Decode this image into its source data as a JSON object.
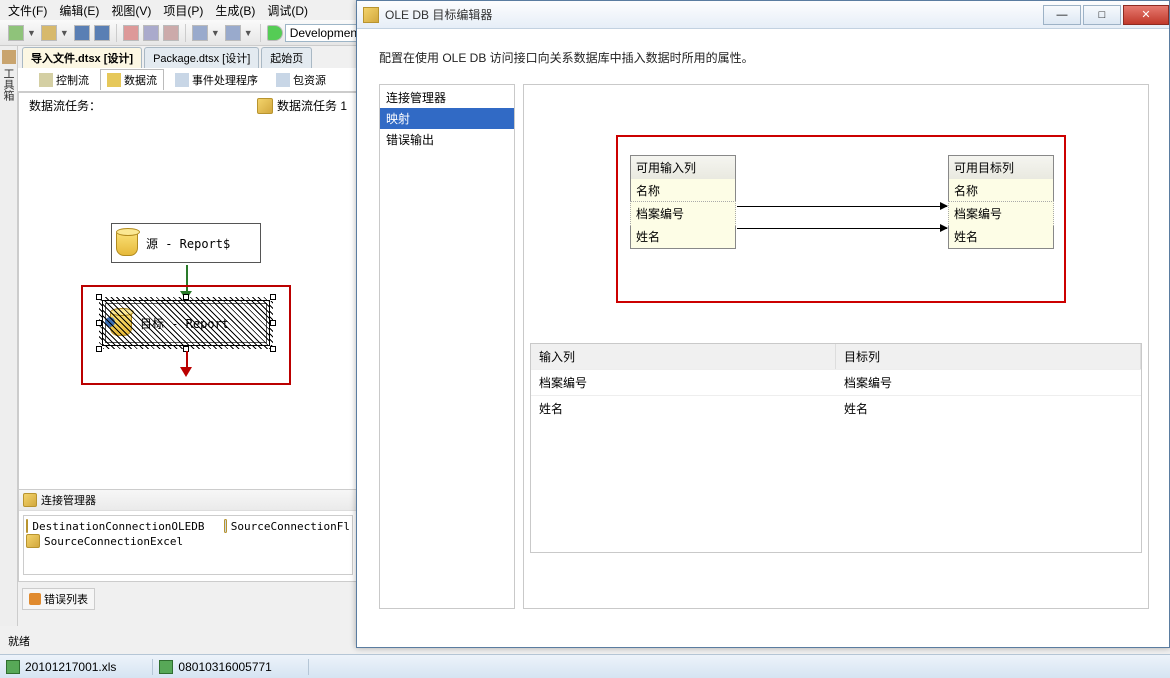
{
  "menu": {
    "file": "文件(F)",
    "edit": "编辑(E)",
    "view": "视图(V)",
    "project": "项目(P)",
    "build": "生成(B)",
    "debug": "调试(D)"
  },
  "toolbar": {
    "config": "Developmen"
  },
  "doctabs": {
    "t1": "导入文件.dtsx [设计]",
    "t2": "Package.dtsx [设计]",
    "t3": "起始页"
  },
  "subtabs": {
    "control": "控制流",
    "data": "数据流",
    "event": "事件处理程序",
    "pkg": "包资源"
  },
  "task": {
    "label": "数据流任务：",
    "name": "数据流任务 1"
  },
  "boxes": {
    "src": "源 - Report$",
    "dst": "目标 - Report"
  },
  "conmgr": {
    "title": "连接管理器",
    "c1": "DestinationConnectionOLEDB",
    "c2": "SourceConnectionFl",
    "c3": "SourceConnectionExcel"
  },
  "errlist": "错误列表",
  "status": "就绪",
  "files": {
    "f1": "20101217001.xls",
    "f2": "08010316005771"
  },
  "dialog": {
    "title": "OLE DB 目标编辑器",
    "desc": "配置在使用 OLE DB 访问接口向关系数据库中插入数据时所用的属性。",
    "nav": {
      "n1": "连接管理器",
      "n2": "映射",
      "n3": "错误输出"
    },
    "left": {
      "hdr": "可用输入列",
      "r1": "名称",
      "r2": "档案编号",
      "r3": "姓名"
    },
    "right": {
      "hdr": "可用目标列",
      "r1": "名称",
      "r2": "档案编号",
      "r3": "姓名"
    },
    "grid": {
      "h1": "输入列",
      "h2": "目标列",
      "r1c1": "档案编号",
      "r1c2": "档案编号",
      "r2c1": "姓名",
      "r2c2": "姓名"
    },
    "win": {
      "min": "—",
      "max": "□",
      "close": "✕"
    }
  },
  "toolbox": "工具箱"
}
